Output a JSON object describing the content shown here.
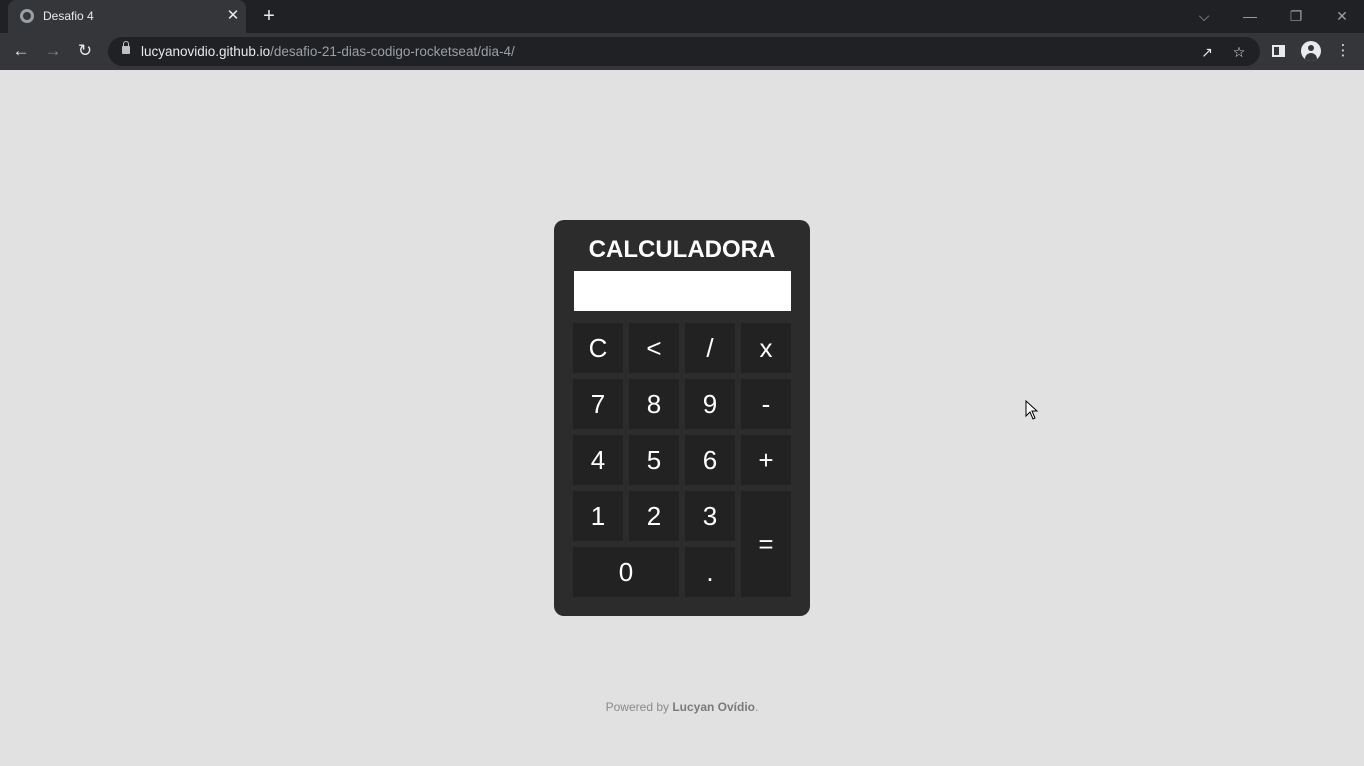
{
  "browser": {
    "tab_title": "Desafio 4",
    "tab_close": "✕",
    "new_tab": "+",
    "url_host": "lucyanovidio.github.io",
    "url_path": "/desafio-21-dias-codigo-rocketseat/dia-4/",
    "window_controls": [
      "⌵",
      "—",
      "❐",
      "✕"
    ]
  },
  "calculator": {
    "title": "CALCULADORA",
    "display_value": "",
    "keys": [
      {
        "label": "C"
      },
      {
        "label": "<"
      },
      {
        "label": "/"
      },
      {
        "label": "x"
      },
      {
        "label": "7"
      },
      {
        "label": "8"
      },
      {
        "label": "9"
      },
      {
        "label": "-"
      },
      {
        "label": "4"
      },
      {
        "label": "5"
      },
      {
        "label": "6"
      },
      {
        "label": "+"
      },
      {
        "label": "1"
      },
      {
        "label": "2"
      },
      {
        "label": "3"
      },
      {
        "label": "="
      },
      {
        "label": "0"
      },
      {
        "label": "."
      }
    ]
  },
  "footer": {
    "prefix": "Powered by ",
    "author": "Lucyan Ovídio",
    "suffix": "."
  }
}
